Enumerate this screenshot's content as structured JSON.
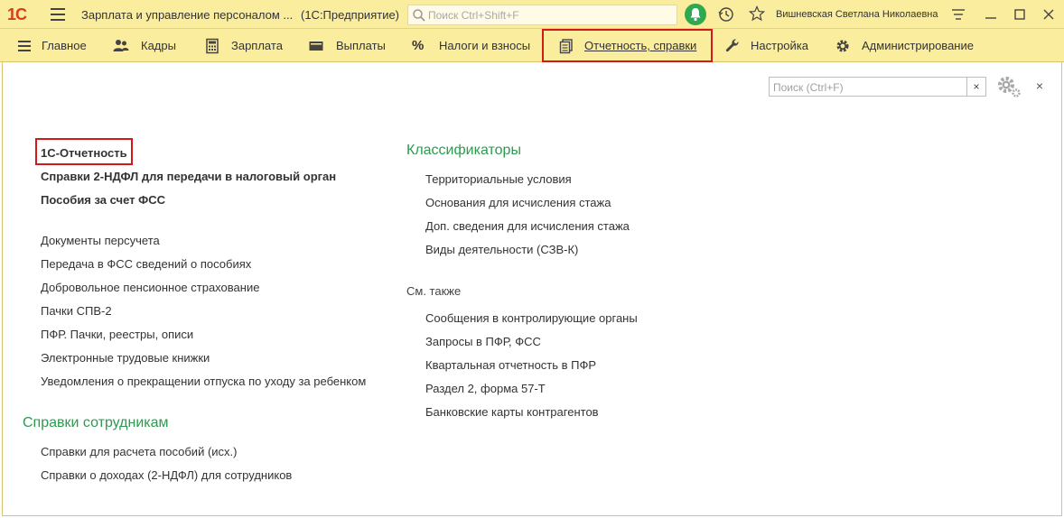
{
  "titlebar": {
    "logo": "1С",
    "app_title": "Зарплата и управление персоналом ...",
    "app_subtitle": "(1С:Предприятие)",
    "search_placeholder": "Поиск Ctrl+Shift+F",
    "user_name": "Вишневская Светлана Николаевна"
  },
  "sections": [
    {
      "label": "Главное",
      "icon": "list-icon"
    },
    {
      "label": "Кадры",
      "icon": "people-icon"
    },
    {
      "label": "Зарплата",
      "icon": "calculator-icon"
    },
    {
      "label": "Выплаты",
      "icon": "wallet-icon"
    },
    {
      "label": "Налоги и взносы",
      "icon": "percent-icon"
    },
    {
      "label": "Отчетность, справки",
      "icon": "documents-icon",
      "active": true
    },
    {
      "label": "Настройка",
      "icon": "wrench-icon"
    },
    {
      "label": "Администрирование",
      "icon": "gear-icon"
    }
  ],
  "panel": {
    "search_placeholder": "Поиск (Ctrl+F)",
    "clear_label": "×",
    "close_label": "×"
  },
  "left_column": {
    "primary_links": [
      "1С-Отчетность",
      "Справки 2-НДФЛ для передачи в налоговый орган",
      "Пособия за счет ФСС"
    ],
    "links": [
      "Документы персучета",
      "Передача в ФСС сведений о пособиях",
      "Добровольное пенсионное страхование",
      "Пачки СПВ-2",
      "ПФР. Пачки, реестры, описи",
      "Электронные трудовые книжки",
      "Уведомления о прекращении отпуска по уходу за ребенком"
    ],
    "group_title": "Справки сотрудникам",
    "group_links": [
      "Справки для расчета пособий (исх.)",
      "Справки о доходах (2-НДФЛ) для сотрудников"
    ]
  },
  "right_column": {
    "group_title": "Классификаторы",
    "group_links": [
      "Территориальные условия",
      "Основания для исчисления стажа",
      "Доп. сведения для исчисления стажа",
      "Виды деятельности (СЗВ-К)"
    ],
    "see_also_title": "См. также",
    "see_also_links": [
      "Сообщения в контролирующие органы",
      "Запросы в ПФР, ФСС",
      "Квартальная отчетность в ПФР",
      "Раздел 2, форма 57-Т",
      "Банковские карты контрагентов"
    ]
  },
  "colors": {
    "toolbar_bg": "#fbed9e",
    "group_title": "#2c9a4f",
    "highlight_frame": "#d31a1a",
    "logo": "#d63c1f"
  }
}
